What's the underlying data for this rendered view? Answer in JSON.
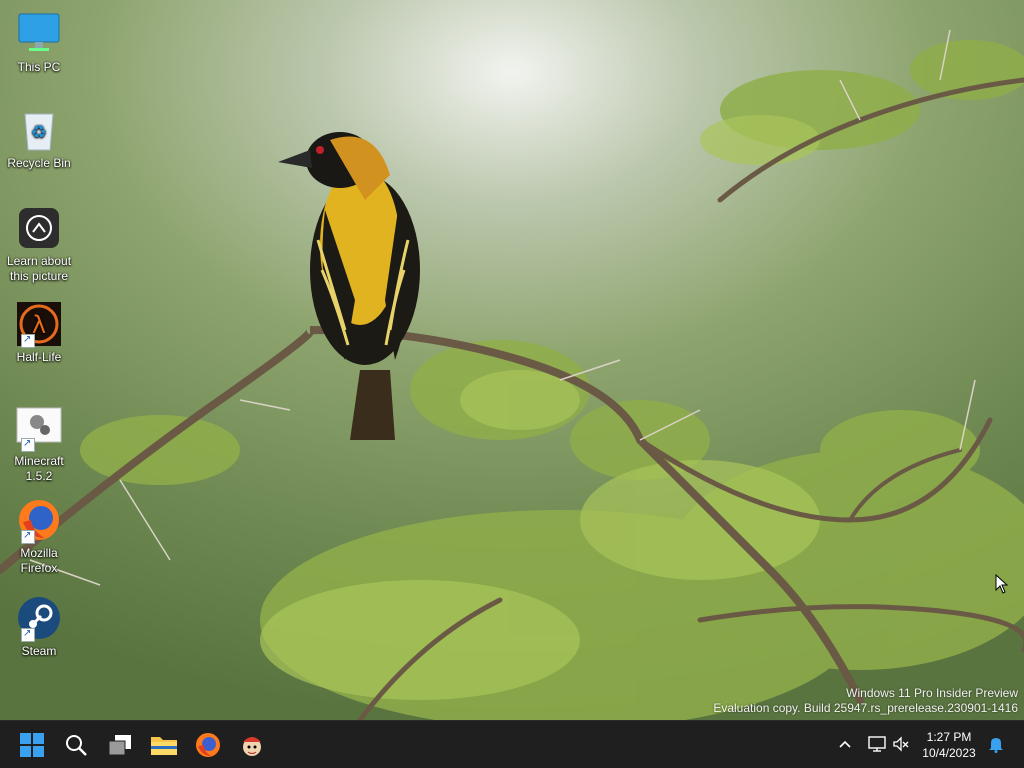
{
  "desktop": {
    "icons": [
      {
        "label": "This PC",
        "icon": "this-pc-icon"
      },
      {
        "label": "Recycle Bin",
        "icon": "recycle-bin-icon"
      },
      {
        "label": "Learn about this picture",
        "icon": "learn-about-picture-icon"
      },
      {
        "label": "Half-Life",
        "icon": "half-life-icon",
        "shortcut": true
      },
      {
        "label": "Minecraft 1.5.2",
        "icon": "minecraft-icon",
        "shortcut": true
      },
      {
        "label": "Mozilla Firefox",
        "icon": "firefox-icon",
        "shortcut": true
      },
      {
        "label": "Steam",
        "icon": "steam-icon",
        "shortcut": true
      }
    ]
  },
  "watermark": {
    "line1": "Windows 11 Pro Insider Preview",
    "line2": "Evaluation copy. Build 25947.rs_prerelease.230901-1416"
  },
  "taskbar": {
    "pinned": [
      {
        "name": "start-button",
        "icon": "windows-logo-icon"
      },
      {
        "name": "search-button",
        "icon": "search-icon"
      },
      {
        "name": "task-view-button",
        "icon": "task-view-icon"
      },
      {
        "name": "file-explorer-button",
        "icon": "folder-icon"
      },
      {
        "name": "firefox-taskbar-button",
        "icon": "firefox-icon"
      },
      {
        "name": "app-taskbar-button",
        "icon": "cartoon-app-icon"
      }
    ],
    "tray": {
      "chevron": "chevron-up-icon",
      "network": "network-icon",
      "volume": "volume-muted-icon",
      "notification": "bell-icon"
    },
    "clock": {
      "time": "1:27 PM",
      "date": "10/4/2023"
    }
  },
  "colors": {
    "taskbar": "#1f1f1f",
    "accent": "#0078d4",
    "bird_yellow": "#e2b321"
  }
}
